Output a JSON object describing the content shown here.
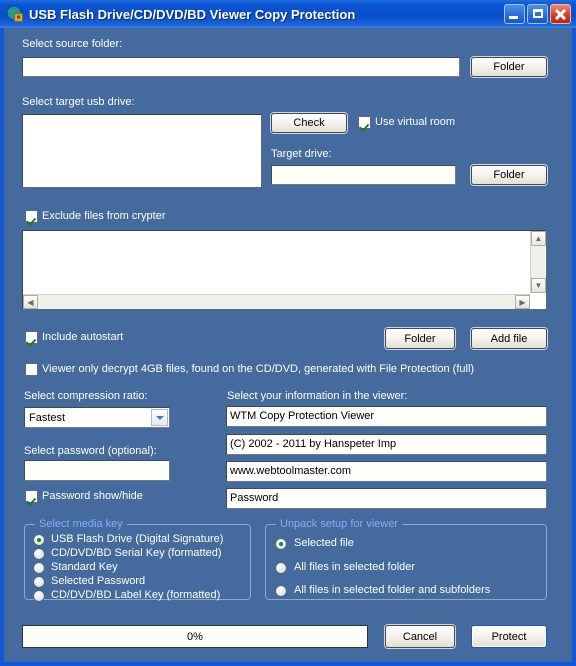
{
  "window": {
    "title": "USB Flash Drive/CD/DVD/BD Viewer Copy Protection",
    "icon": "globe-shield-icon",
    "minimize_label": "Minimize",
    "maximize_label": "Maximize",
    "close_label": "Close",
    "bg_color": "#456a9e",
    "titlebar_color": "#0a4ecb",
    "group_title_color": "#7fb0f5"
  },
  "source": {
    "label": "Select source folder:",
    "value": "",
    "folder_button": "Folder"
  },
  "target": {
    "label": "Select target usb drive:",
    "list_value": "",
    "check_button": "Check",
    "virtual_room_label": "Use virtual room",
    "virtual_room_checked": true,
    "target_drive_label": "Target drive:",
    "target_drive_value": "",
    "folder_button": "Folder"
  },
  "exclude": {
    "label": "Exclude files from crypter",
    "checked": true,
    "list_value": ""
  },
  "autostart": {
    "label": "Include autostart",
    "checked": true,
    "folder_button": "Folder",
    "add_file_button": "Add file"
  },
  "viewer_decrypt": {
    "label": "Viewer only decrypt 4GB files, found on the CD/DVD, generated with File Protection (full)",
    "checked": false
  },
  "compression": {
    "label": "Select compression ratio:",
    "selected": "Fastest",
    "options": [
      "Fastest"
    ]
  },
  "password": {
    "label": "Select password (optional):",
    "value": "",
    "show_hide_label": "Password show/hide",
    "show_hide_checked": true
  },
  "viewer_info": {
    "label": "Select your information in the viewer:",
    "line1": "WTM Copy Protection Viewer",
    "line2": "(C) 2002 - 2011 by Hanspeter Imp",
    "line3": "www.webtoolmaster.com",
    "line4": "Password"
  },
  "media_key": {
    "title": "Select media key",
    "options": [
      {
        "label": "USB Flash Drive (Digital Signature)",
        "selected": true
      },
      {
        "label": "CD/DVD/BD Serial Key (formatted)",
        "selected": false
      },
      {
        "label": "Standard Key",
        "selected": false
      },
      {
        "label": "Selected Password",
        "selected": false
      },
      {
        "label": "CD/DVD/BD Label Key (formatted)",
        "selected": false
      }
    ]
  },
  "unpack": {
    "title": "Unpack setup for viewer",
    "options": [
      {
        "label": "Selected file",
        "selected": true
      },
      {
        "label": "All files in selected folder",
        "selected": false
      },
      {
        "label": "All files in selected folder and subfolders",
        "selected": false
      }
    ]
  },
  "footer": {
    "progress_text": "0%",
    "progress_percent": 0,
    "cancel_button": "Cancel",
    "protect_button": "Protect"
  }
}
